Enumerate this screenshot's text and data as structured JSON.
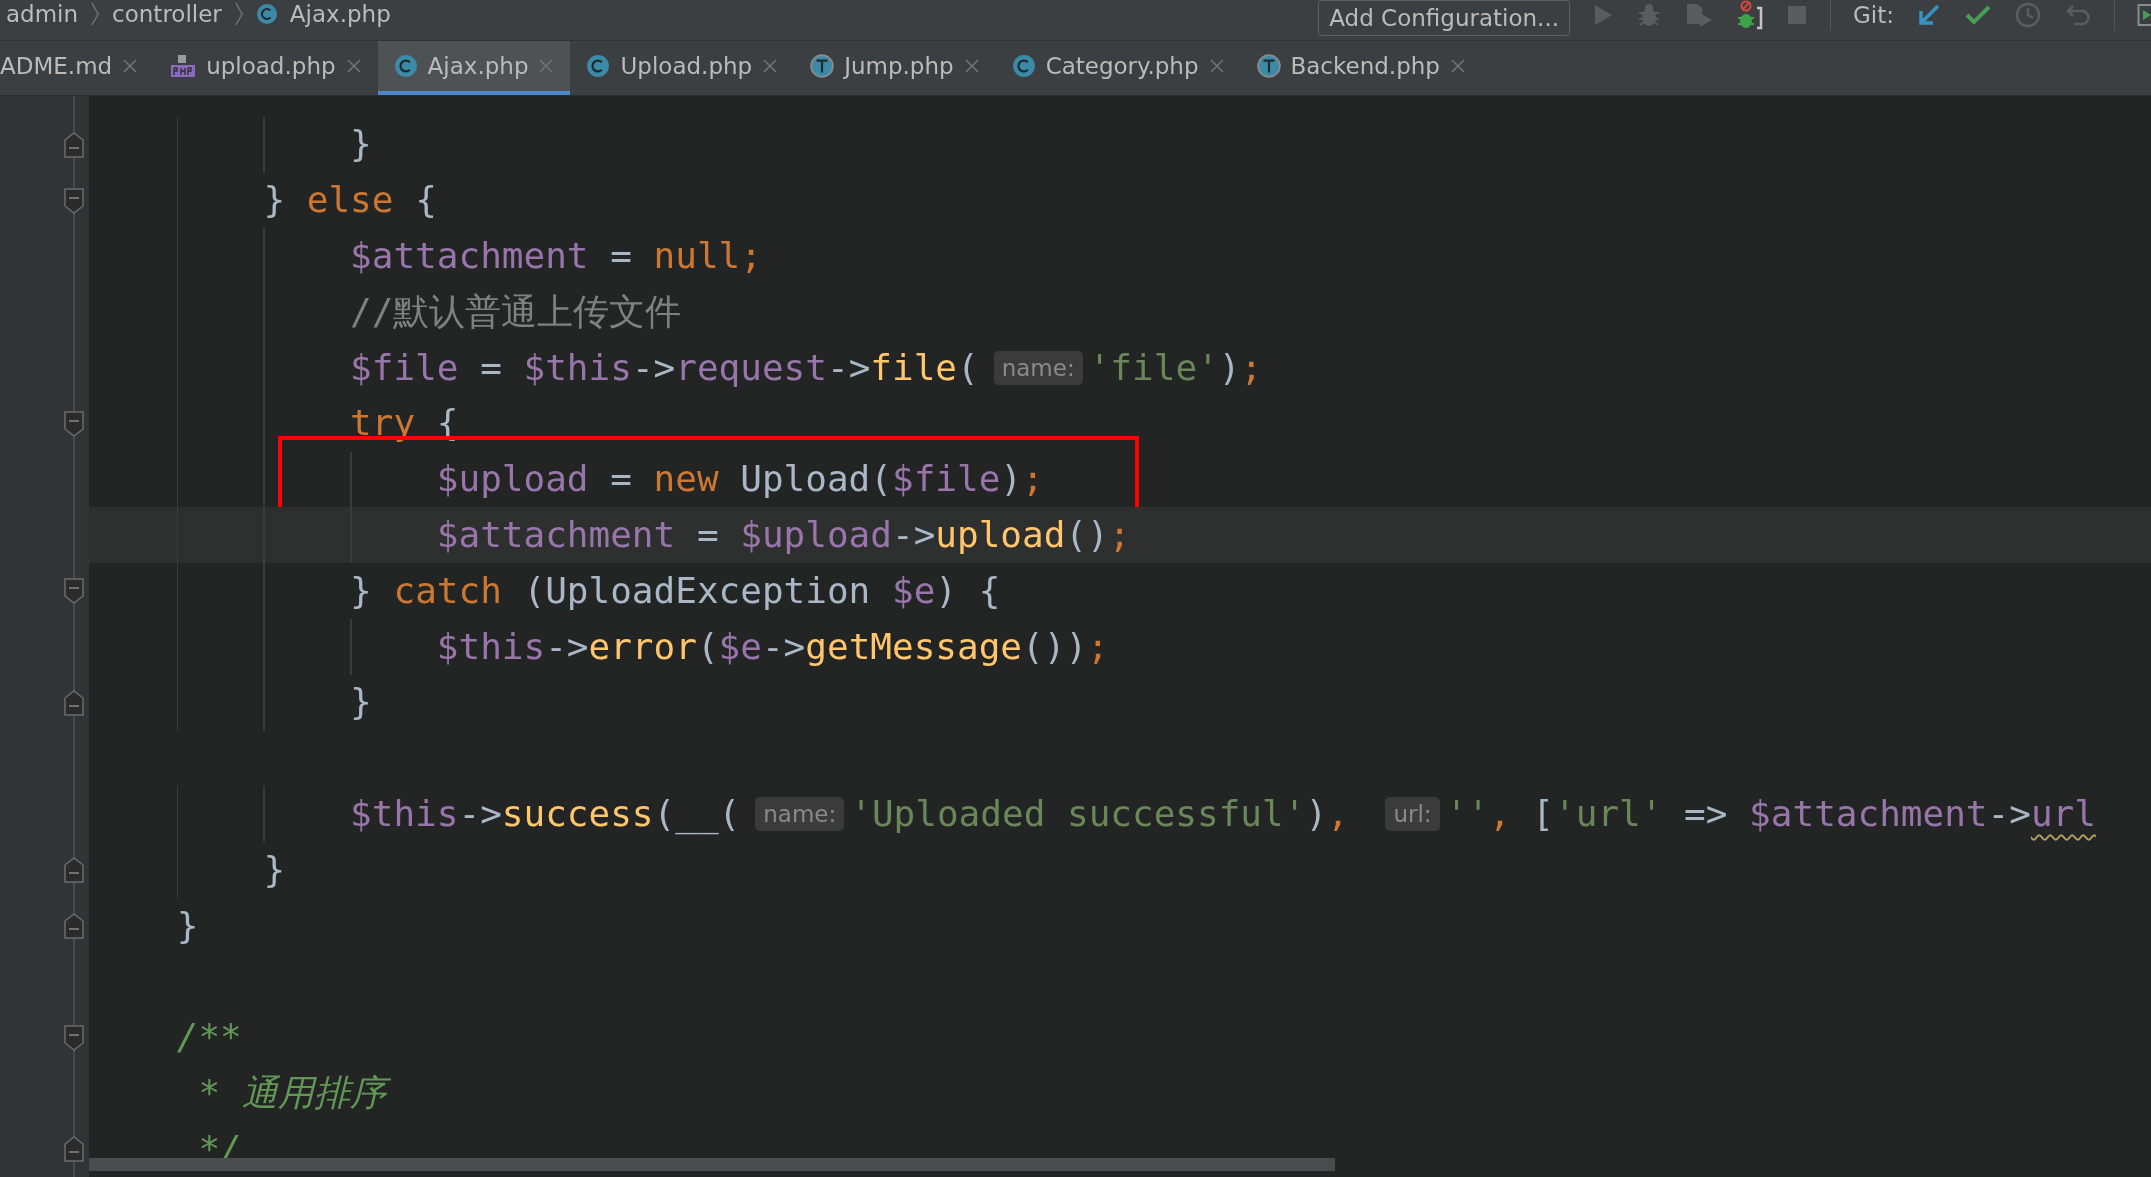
{
  "breadcrumbs": [
    {
      "label": "admin"
    },
    {
      "label": "controller"
    },
    {
      "label": "Ajax.php",
      "kind": "class"
    }
  ],
  "toolbar": {
    "configuration_button": "Add Configuration...",
    "vcs_label": "Git:"
  },
  "tabs": [
    {
      "label": "ADME.md",
      "kind": "text",
      "selected": false
    },
    {
      "label": "upload.php",
      "kind": "php",
      "selected": false
    },
    {
      "label": "Ajax.php",
      "kind": "class",
      "selected": true
    },
    {
      "label": "Upload.php",
      "kind": "class",
      "selected": false
    },
    {
      "label": "Jump.php",
      "kind": "trait",
      "selected": false
    },
    {
      "label": "Category.php",
      "kind": "class",
      "selected": false
    },
    {
      "label": "Backend.php",
      "kind": "trait",
      "selected": false
    }
  ],
  "editor": {
    "lines": [
      {
        "kind": "fold-end",
        "tokens": [
          {
            "kind": "plain",
            "text": "            }"
          }
        ]
      },
      {
        "kind": "fold-start",
        "tokens": [
          {
            "kind": "plain",
            "text": "        } "
          },
          {
            "kind": "keyword",
            "text": "else"
          },
          {
            "kind": "plain",
            "text": " {"
          }
        ]
      },
      {
        "kind": "code",
        "tokens": [
          {
            "kind": "var",
            "text": "            $attachment"
          },
          {
            "kind": "plain",
            "text": " = "
          },
          {
            "kind": "keyword",
            "text": "null"
          },
          {
            "kind": "punct",
            "text": ";"
          }
        ]
      },
      {
        "kind": "code",
        "tokens": [
          {
            "kind": "comment",
            "text": "            //默认普通上传文件"
          }
        ]
      },
      {
        "kind": "code",
        "tokens": [
          {
            "kind": "var",
            "text": "            $file"
          },
          {
            "kind": "plain",
            "text": " = "
          },
          {
            "kind": "var",
            "text": "$this"
          },
          {
            "kind": "plain",
            "text": "->"
          },
          {
            "kind": "var",
            "text": "request"
          },
          {
            "kind": "plain",
            "text": "->"
          },
          {
            "kind": "func",
            "text": "file"
          },
          {
            "kind": "plain",
            "text": "("
          },
          {
            "kind": "hint",
            "text": "name:"
          },
          {
            "kind": "string",
            "text": "'file'"
          },
          {
            "kind": "plain",
            "text": ")"
          },
          {
            "kind": "punct",
            "text": ";"
          }
        ]
      },
      {
        "kind": "fold-start",
        "tokens": [
          {
            "kind": "keyword",
            "text": "            try"
          },
          {
            "kind": "plain",
            "text": " {"
          }
        ]
      },
      {
        "kind": "code",
        "boxed": true,
        "tokens": [
          {
            "kind": "var",
            "text": "                $upload"
          },
          {
            "kind": "plain",
            "text": " = "
          },
          {
            "kind": "keyword",
            "text": "new"
          },
          {
            "kind": "plain",
            "text": " Upload("
          },
          {
            "kind": "var",
            "text": "$file"
          },
          {
            "kind": "plain",
            "text": ")"
          },
          {
            "kind": "punct",
            "text": ";"
          }
        ]
      },
      {
        "kind": "code",
        "current": true,
        "tokens": [
          {
            "kind": "var",
            "text": "                $attachment"
          },
          {
            "kind": "plain",
            "text": " = "
          },
          {
            "kind": "var",
            "text": "$upload"
          },
          {
            "kind": "plain",
            "text": "->"
          },
          {
            "kind": "func",
            "text": "upload"
          },
          {
            "kind": "plain",
            "text": "()"
          },
          {
            "kind": "punct",
            "text": ";"
          }
        ]
      },
      {
        "kind": "fold-start",
        "tokens": [
          {
            "kind": "plain",
            "text": "            } "
          },
          {
            "kind": "keyword",
            "text": "catch"
          },
          {
            "kind": "plain",
            "text": " (UploadException "
          },
          {
            "kind": "var",
            "text": "$e"
          },
          {
            "kind": "plain",
            "text": ") {"
          }
        ]
      },
      {
        "kind": "code",
        "tokens": [
          {
            "kind": "var",
            "text": "                $this"
          },
          {
            "kind": "plain",
            "text": "->"
          },
          {
            "kind": "func",
            "text": "error"
          },
          {
            "kind": "plain",
            "text": "("
          },
          {
            "kind": "var",
            "text": "$e"
          },
          {
            "kind": "plain",
            "text": "->"
          },
          {
            "kind": "func",
            "text": "getMessage"
          },
          {
            "kind": "plain",
            "text": "())"
          },
          {
            "kind": "punct",
            "text": ";"
          }
        ]
      },
      {
        "kind": "fold-end",
        "tokens": [
          {
            "kind": "plain",
            "text": "            }"
          }
        ]
      },
      {
        "kind": "blank"
      },
      {
        "kind": "code",
        "tokens": [
          {
            "kind": "var",
            "text": "            $this"
          },
          {
            "kind": "plain",
            "text": "->"
          },
          {
            "kind": "func",
            "text": "success"
          },
          {
            "kind": "plain",
            "text": "(__("
          },
          {
            "kind": "hint",
            "text": "name:"
          },
          {
            "kind": "string",
            "text": "'Uploaded successful'"
          },
          {
            "kind": "plain",
            "text": ")"
          },
          {
            "kind": "punct",
            "text": ", "
          },
          {
            "kind": "hint",
            "text": "url:"
          },
          {
            "kind": "string",
            "text": "''"
          },
          {
            "kind": "punct",
            "text": ", "
          },
          {
            "kind": "plain",
            "text": "["
          },
          {
            "kind": "string",
            "text": "'url'"
          },
          {
            "kind": "plain",
            "text": " => "
          },
          {
            "kind": "var",
            "text": "$attachment"
          },
          {
            "kind": "plain",
            "text": "->"
          },
          {
            "kind": "warn",
            "text": "url"
          }
        ]
      },
      {
        "kind": "fold-end",
        "tokens": [
          {
            "kind": "plain",
            "text": "        }"
          }
        ]
      },
      {
        "kind": "fold-end",
        "tokens": [
          {
            "kind": "plain",
            "text": "    }"
          }
        ]
      },
      {
        "kind": "blank"
      },
      {
        "kind": "fold-start",
        "tokens": [
          {
            "kind": "doc",
            "text": "    /**"
          }
        ]
      },
      {
        "kind": "code",
        "tokens": [
          {
            "kind": "doc",
            "text": "     * 通用排序"
          }
        ]
      },
      {
        "kind": "fold-end",
        "tokens": [
          {
            "kind": "doc",
            "text": "     */"
          }
        ]
      }
    ]
  }
}
